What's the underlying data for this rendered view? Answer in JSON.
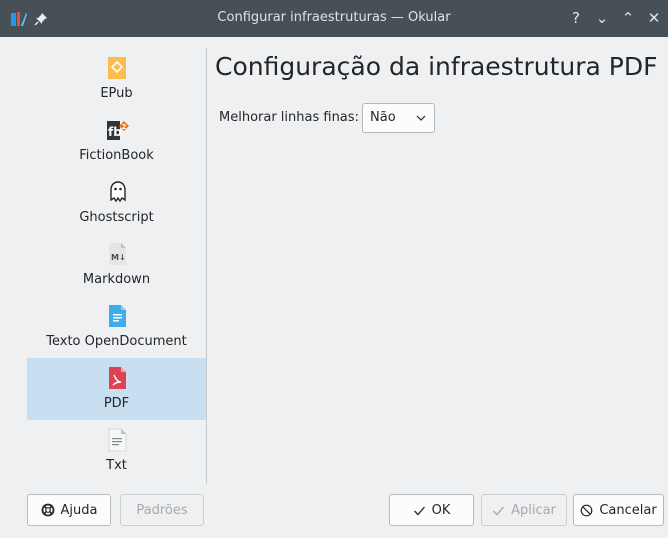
{
  "window": {
    "title": "Configurar infraestruturas — Okular",
    "controls": [
      "help-icon",
      "minimize-icon",
      "maximize-icon",
      "close-icon"
    ],
    "help_glyph": "?",
    "minimize_glyph": "⌄",
    "maximize_glyph": "⌃",
    "close_glyph": "✕"
  },
  "sidebar": {
    "items": [
      {
        "label": "EPub",
        "icon": "epub-icon",
        "selected": false
      },
      {
        "label": "FictionBook",
        "icon": "fictionbook-icon",
        "selected": false
      },
      {
        "label": "Ghostscript",
        "icon": "ghostscript-icon",
        "selected": false
      },
      {
        "label": "Markdown",
        "icon": "markdown-icon",
        "selected": false
      },
      {
        "label": "Texto OpenDocument",
        "icon": "opendocument-text-icon",
        "selected": false
      },
      {
        "label": "PDF",
        "icon": "pdf-icon",
        "selected": true
      },
      {
        "label": "Txt",
        "icon": "txt-icon",
        "selected": false
      }
    ]
  },
  "main": {
    "title": "Configuração da infraestrutura PDF",
    "option_label": "Melhorar linhas finas:",
    "option_value": "Não"
  },
  "buttons": {
    "help": "Ajuda",
    "defaults": "Padrões",
    "ok": "OK",
    "apply": "Aplicar",
    "cancel": "Cancelar"
  },
  "colors": {
    "titlebar": "#475057",
    "selection": "#c8dff2",
    "pdf_red": "#da4453",
    "epub_yellow": "#fdbc4b",
    "odt_blue": "#3daee9"
  }
}
